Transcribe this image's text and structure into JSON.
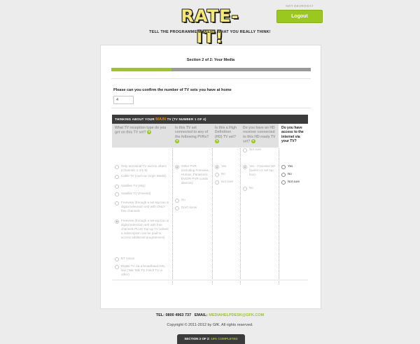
{
  "header": {
    "logo_text": "RATE-IT!",
    "tagline": "TELL THE PROGRAMME MAKERS WHAT YOU REALLY THINK!",
    "not_user_text": "NOT DEVROGA?",
    "logout_label": "Logout"
  },
  "section": {
    "title": "Section 2 of 2: Your Media",
    "progress_fraction": 0.3
  },
  "question": {
    "label": "Please can you confirm the number of TV sets you have at home",
    "value": "4"
  },
  "tv_table": {
    "header_prefix": "THINKING ABOUT YOUR ",
    "header_main": "MAIN",
    "header_suffix": " TV (TV NUMBER 1 OF 4)",
    "help_glyph": "?",
    "columns": [
      {
        "question": "What TV reception type do you get on this TV set?",
        "options": [
          {
            "label": "Only terrestrial TV and no others (Channels 1-4/1-5)",
            "selected": false
          },
          {
            "label": "Cable TV (such as Virgin Media)",
            "selected": false
          },
          {
            "label": "Satellite TV (Sky)",
            "selected": false
          },
          {
            "label": "Satellite TV (Freesat)",
            "selected": false
          },
          {
            "label": "Freeview (through a set-top box or digital television set) with ONLY free channels",
            "selected": false
          },
          {
            "label": "Freeview (through a set-top box or digital television set) with free channels PLUS Top-up TV (where a subscription can be paid to access additional programmes)",
            "selected": true
          },
          {
            "label": "BT Vision",
            "selected": false
          },
          {
            "label": "Digital TV via a broadband DSL line (Talk Talk TV, Fetch TV or other)",
            "selected": false
          }
        ]
      },
      {
        "question": "Is this TV set connected to any of the following PVRs?",
        "options": [
          {
            "label": "Other PVR (including Freeview, Humax, Panasonic, DVD/R-PVR combi devices)",
            "selected": true
          },
          {
            "label": "No",
            "selected": false
          },
          {
            "label": "Don't know",
            "selected": false
          }
        ]
      },
      {
        "question": "Is this a High Definition (HD) TV set?",
        "options": [
          {
            "label": "Yes",
            "selected": true
          },
          {
            "label": "No",
            "selected": false
          },
          {
            "label": "Not sure",
            "selected": false
          }
        ]
      },
      {
        "question": "Do you have an HD receiver connected to this HD-ready TV set?",
        "options": [
          {
            "label": "Yes - Freeview HD (built-in or set top box)",
            "selected": true
          },
          {
            "label": "No",
            "selected": false
          },
          {
            "label": "Not sure",
            "selected": false
          }
        ]
      },
      {
        "question": "Do you have access to the internet via your TV?",
        "options": [
          {
            "label": "Yes",
            "selected": false
          },
          {
            "label": "No",
            "selected": false
          },
          {
            "label": "Not sure",
            "selected": false
          }
        ]
      }
    ]
  },
  "footer": {
    "tel_label": "TEL: 0800 4963 737",
    "email_label": "EMAIL: ",
    "email": "MEDIAHELPDESK@GFK.COM",
    "copyright": "Copyright © 2011-2012 by GfK. All rights reserved.",
    "bar_section": "SECTION 2 OF 2: ",
    "bar_percent": "19% COMPLETED"
  }
}
